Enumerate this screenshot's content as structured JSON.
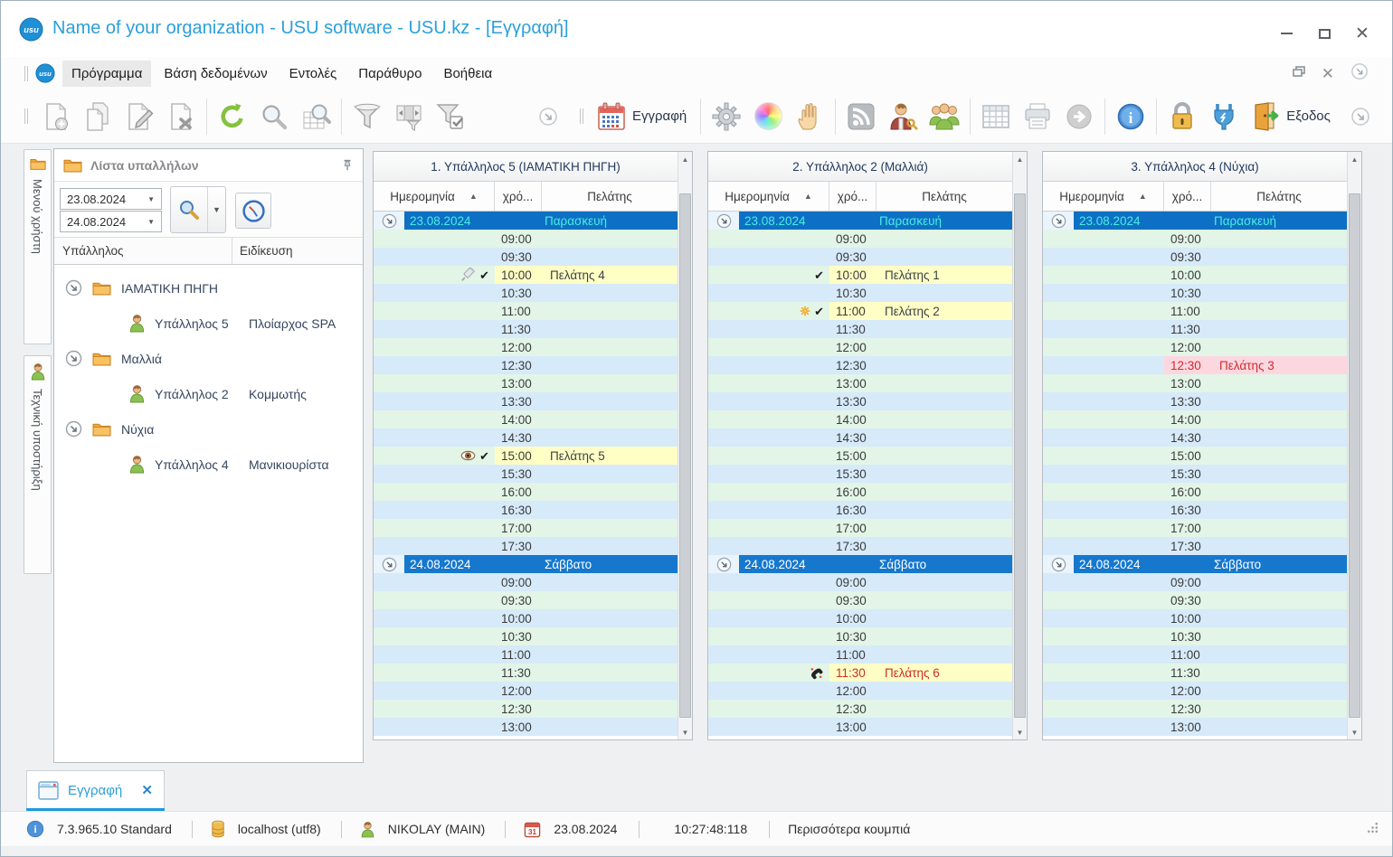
{
  "window": {
    "title": "Name of your organization - USU software - USU.kz - [Εγγραφή]",
    "logo_text": "usu"
  },
  "menu": {
    "items": [
      "Πρόγραμμα",
      "Βάση δεδομένων",
      "Εντολές",
      "Παράθυρο",
      "Βοήθεια"
    ]
  },
  "toolbar": {
    "record_label": "Εγγραφή",
    "exit_label": "Εξοδος",
    "icons": [
      "add-record",
      "copy-record",
      "edit-record",
      "delete-record",
      "refresh",
      "search",
      "search-table",
      "filter",
      "filter-range",
      "filter-apply",
      "overflow-chevron",
      "record-calendar",
      "settings-gear",
      "color-wheel",
      "drag-hand",
      "news-feed",
      "user-access",
      "employees-group",
      "table-view",
      "print",
      "go-next",
      "info",
      "lock",
      "connection-plug",
      "exit-door"
    ]
  },
  "side_tabs": [
    {
      "label": "Μενού χρήστη",
      "icon": "folder-icon"
    },
    {
      "label": "Τεχνική υποστήριξη",
      "icon": "user-icon"
    }
  ],
  "employee_panel": {
    "title": "Λίστα υπαλλήλων",
    "date_from": "23.08.2024",
    "date_to": "24.08.2024",
    "columns": {
      "employee": "Υπάλληλος",
      "specialty": "Ειδίκευση"
    },
    "groups": [
      {
        "name": "ΙΑΜΑΤΙΚΗ ΠΗΓΗ",
        "employees": [
          {
            "name": "Υπάλληλος 5",
            "specialty": "Πλοίαρχος SPA"
          }
        ]
      },
      {
        "name": "Μαλλιά",
        "employees": [
          {
            "name": "Υπάλληλος 2",
            "specialty": "Κομμωτής"
          }
        ]
      },
      {
        "name": "Νύχια",
        "employees": [
          {
            "name": "Υπάλληλος 4",
            "specialty": "Μανικιουρίστα"
          }
        ]
      }
    ]
  },
  "schedule": {
    "column_headers": {
      "date": "Ημερομηνία",
      "time": "χρό...",
      "client": "Πελάτης"
    },
    "sort_glyph": "▲",
    "times": {
      "friday": [
        "09:00",
        "09:30",
        "10:00",
        "10:30",
        "11:00",
        "11:30",
        "12:00",
        "12:30",
        "13:00",
        "13:30",
        "14:00",
        "14:30",
        "15:00",
        "15:30",
        "16:00",
        "16:30",
        "17:00",
        "17:30"
      ],
      "saturday": [
        "09:00",
        "09:30",
        "10:00",
        "10:30",
        "11:00",
        "11:30",
        "12:00",
        "12:30",
        "13:00"
      ]
    },
    "panels": [
      {
        "title": "1. Υπάλληλος 5 (ΙΑΜΑΤΙΚΗ ΠΗΓΗ)",
        "days": [
          {
            "date": "23.08.2024",
            "weekday": "Παρασκευή",
            "selected": true,
            "times_key": "friday",
            "appointments": [
              {
                "time": "10:00",
                "client": "Πελάτης 4",
                "icons": [
                  "syringe-icon",
                  "check-icon"
                ],
                "highlight": "yellow",
                "text_color": "dark"
              },
              {
                "time": "15:00",
                "client": "Πελάτης 5",
                "icons": [
                  "eye-icon",
                  "check-icon"
                ],
                "highlight": "yellow",
                "text_color": "dark"
              }
            ]
          },
          {
            "date": "24.08.2024",
            "weekday": "Σάββατο",
            "selected": false,
            "times_key": "saturday",
            "appointments": []
          }
        ]
      },
      {
        "title": "2. Υπάλληλος 2 (Μαλλιά)",
        "days": [
          {
            "date": "23.08.2024",
            "weekday": "Παρασκευή",
            "selected": true,
            "times_key": "friday",
            "appointments": [
              {
                "time": "10:00",
                "client": "Πελάτης 1",
                "icons": [
                  "check-icon"
                ],
                "highlight": "yellow",
                "text_color": "dark"
              },
              {
                "time": "11:00",
                "client": "Πελάτης 2",
                "icons": [
                  "sun-icon",
                  "check-icon"
                ],
                "highlight": "yellow",
                "text_color": "dark"
              }
            ]
          },
          {
            "date": "24.08.2024",
            "weekday": "Σάββατο",
            "selected": false,
            "times_key": "saturday",
            "appointments": [
              {
                "time": "11:30",
                "client": "Πελάτης 6",
                "icons": [
                  "phone-icon"
                ],
                "highlight": "yellow",
                "text_color": "red"
              }
            ]
          }
        ]
      },
      {
        "title": "3. Υπάλληλος 4 (Νύχια)",
        "days": [
          {
            "date": "23.08.2024",
            "weekday": "Παρασκευή",
            "selected": true,
            "times_key": "friday",
            "appointments": [
              {
                "time": "12:30",
                "client": "Πελάτης 3",
                "icons": [],
                "highlight": "pink",
                "text_color": "red"
              }
            ]
          },
          {
            "date": "24.08.2024",
            "weekday": "Σάββατο",
            "selected": false,
            "times_key": "saturday",
            "appointments": []
          }
        ]
      }
    ]
  },
  "bottom_tabs": {
    "active_label": "Εγγραφή",
    "close_glyph": "✕"
  },
  "status_bar": {
    "version": "7.3.965.10 Standard",
    "database": "localhost (utf8)",
    "user": "NIKOLAY (MAIN)",
    "date": "23.08.2024",
    "time": "10:27:48:118",
    "more_buttons": "Περισσότερα κουμπιά"
  },
  "colors": {
    "accent": "#2b9fdb",
    "row_green": "#e2f5e7",
    "row_blue": "#d7eafa",
    "appointment_yellow": "#ffffc5",
    "appointment_pink": "#fdd7e0",
    "date_bar_blue": "#1678cd",
    "selected_date_text": "#49eede",
    "red_text": "#cf2b2b"
  }
}
